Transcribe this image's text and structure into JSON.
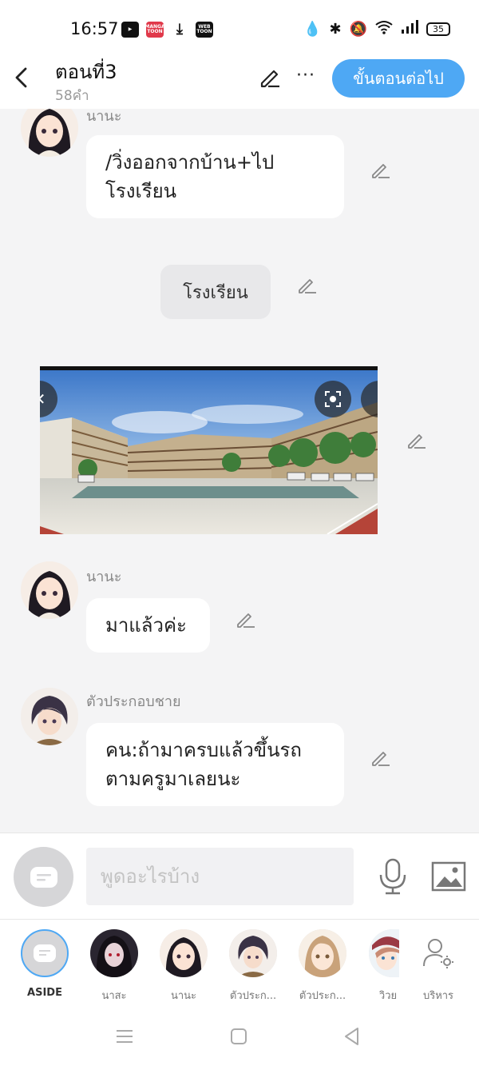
{
  "status_bar": {
    "time": "16:57",
    "apps": [
      "youtube-icon",
      "manga-toon-icon",
      "download-icon",
      "webtoon-icon"
    ],
    "manga_label": "MANGA TOON",
    "webtoon_label": "WEB TOON",
    "battery": "35"
  },
  "header": {
    "title": "ตอนที่3",
    "word_count": "58คำ",
    "more_label": "···",
    "next_button": "ขั้นตอนต่อไป"
  },
  "chat": [
    {
      "type": "dialogue",
      "speaker": "นานะ",
      "text": "/วิ่งออกจากบ้าน+ไป\nโรงเรียน"
    },
    {
      "type": "narration",
      "text": "โรงเรียน"
    },
    {
      "type": "image",
      "description": "school-photo"
    },
    {
      "type": "dialogue",
      "speaker": "นานะ",
      "text": "มาแล้วค่ะ"
    },
    {
      "type": "dialogue",
      "speaker": "ตัวประกอบชาย",
      "text": "คน:ถ้ามาครบแล้วขึ้นรถ\nตามครูมาเลยนะ"
    }
  ],
  "input": {
    "placeholder": "พูดอะไรบ้าง"
  },
  "characters": [
    {
      "name": "ASIDE",
      "selected": true
    },
    {
      "name": "นาสะ",
      "selected": false
    },
    {
      "name": "นานะ",
      "selected": false
    },
    {
      "name": "ตัวประก...",
      "selected": false
    },
    {
      "name": "ตัวประก...",
      "selected": false
    },
    {
      "name": "วิวย",
      "selected": false
    },
    {
      "name": "บริหาร",
      "selected": false
    }
  ],
  "colors": {
    "accent": "#4ea8f4",
    "background": "#f4f4f5",
    "bubble": "#ffffff",
    "narration": "#e8e8ea"
  }
}
